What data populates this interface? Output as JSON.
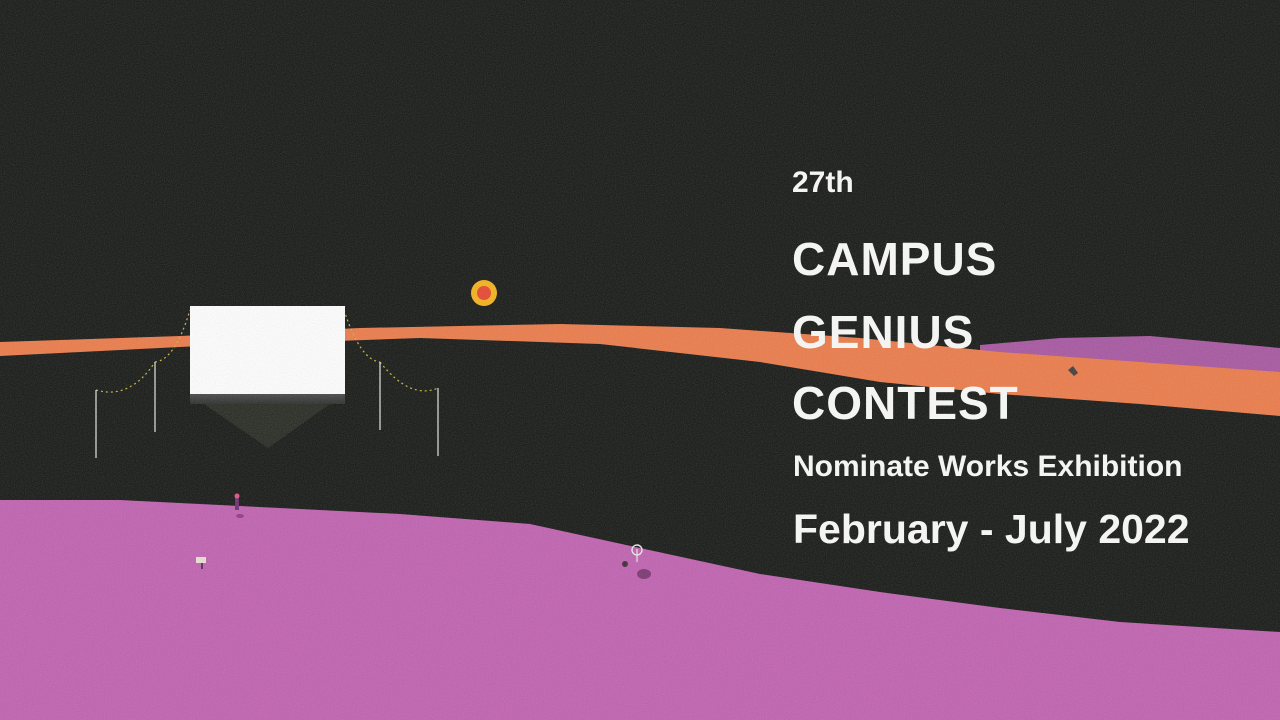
{
  "exhibition": {
    "edition": "27th",
    "title_lines": [
      "CAMPUS",
      "GENIUS",
      "CONTEST"
    ],
    "subtitle": "Nominate Works Exhibition",
    "dates": "February - July 2022"
  },
  "colors": {
    "background": "#141613",
    "ground": "#c060b0",
    "band": "#ec7a48",
    "sun": "#f5b21a",
    "text": "#f4f4f2"
  }
}
